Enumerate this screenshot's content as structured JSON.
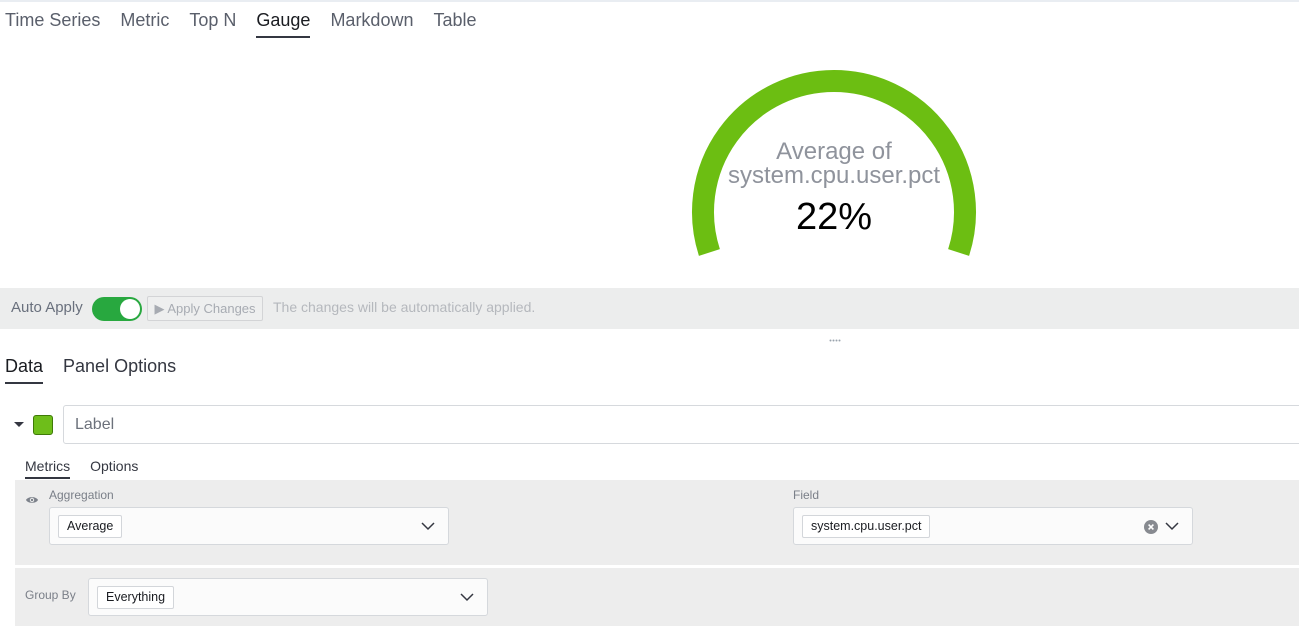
{
  "viz_tabs": [
    {
      "label": "Time Series",
      "active": false
    },
    {
      "label": "Metric",
      "active": false
    },
    {
      "label": "Top N",
      "active": false
    },
    {
      "label": "Gauge",
      "active": true
    },
    {
      "label": "Markdown",
      "active": false
    },
    {
      "label": "Table",
      "active": false
    }
  ],
  "gauge": {
    "label_line1": "Average of",
    "label_line2": "system.cpu.user.pct",
    "value_text": "22%",
    "fill_fraction": 0.22,
    "color": "#6cbe12"
  },
  "apply_bar": {
    "auto_apply_label": "Auto Apply",
    "auto_apply_on": true,
    "apply_button_label": "▶ Apply Changes",
    "note": "The changes will be automatically applied."
  },
  "panel_tabs": [
    {
      "label": "Data",
      "active": true
    },
    {
      "label": "Panel Options",
      "active": false
    }
  ],
  "series": {
    "color": "#6ebe1a",
    "label_placeholder": "Label",
    "label_value": "",
    "inner_tabs": [
      {
        "label": "Metrics",
        "active": true
      },
      {
        "label": "Options",
        "active": false
      }
    ],
    "aggregation": {
      "caption": "Aggregation",
      "value": "Average"
    },
    "field": {
      "caption": "Field",
      "value": "system.cpu.user.pct"
    },
    "group_by": {
      "caption": "Group By",
      "value": "Everything"
    }
  },
  "icons": {
    "visibility": "eye-icon",
    "expand": "caret-down-icon",
    "dropdown": "chevron-down-icon",
    "clear": "clear-icon",
    "resize": "drag-handle-icon"
  }
}
